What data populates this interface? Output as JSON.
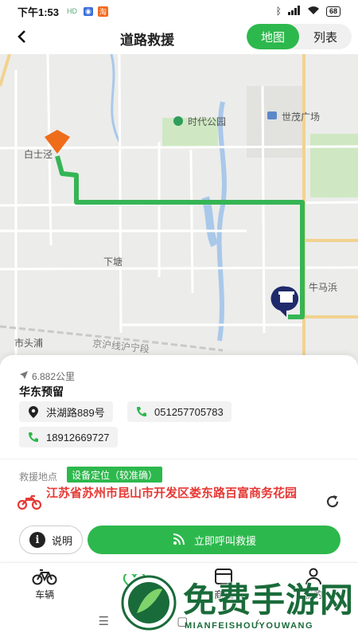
{
  "status_bar": {
    "time": "下午1:53",
    "mini_icons": [
      "HD",
      "淘",
      "淘"
    ],
    "battery": "68"
  },
  "header": {
    "back_icon": "back-arrow-icon",
    "title": "道路救援",
    "toggle": [
      {
        "label": "地图",
        "active": true
      },
      {
        "label": "列表",
        "active": false
      }
    ]
  },
  "map": {
    "labels": {
      "park": "时代公园",
      "plaza": "世茂广场",
      "baishi": "白士泾",
      "xiatang": "下塘",
      "niumabang": "牛马浜",
      "shitoupu": "市头浦",
      "railway": "京沪线沪宁段"
    },
    "route_color": "#35b555",
    "origin_color": "#ef6c1a",
    "destination_color": "#1f2a6b"
  },
  "station": {
    "distance": "6.882公里",
    "name": "华东预留",
    "address": "洪湖路889号",
    "phone1": "051257705783",
    "phone2": "18912669727"
  },
  "rescue": {
    "label": "救援地点",
    "badge": "设备定位（较准确）",
    "address": "江苏省苏州市昆山市开发区娄东路百富商务花园"
  },
  "actions": {
    "info_label": "说明",
    "call_label": "立即呼叫救援"
  },
  "tabs": [
    {
      "label": "车辆",
      "icon": "bicycle-icon"
    },
    {
      "label": "",
      "icon": "heart-icon"
    },
    {
      "label": "商城",
      "icon": "store-icon"
    },
    {
      "label": "我的",
      "icon": "user-icon"
    }
  ],
  "watermark": {
    "text": "免费手游网",
    "sub": "MIANFEISHOUYOUWANG"
  },
  "colors": {
    "accent": "#2db84d",
    "address_red": "#e53935"
  }
}
